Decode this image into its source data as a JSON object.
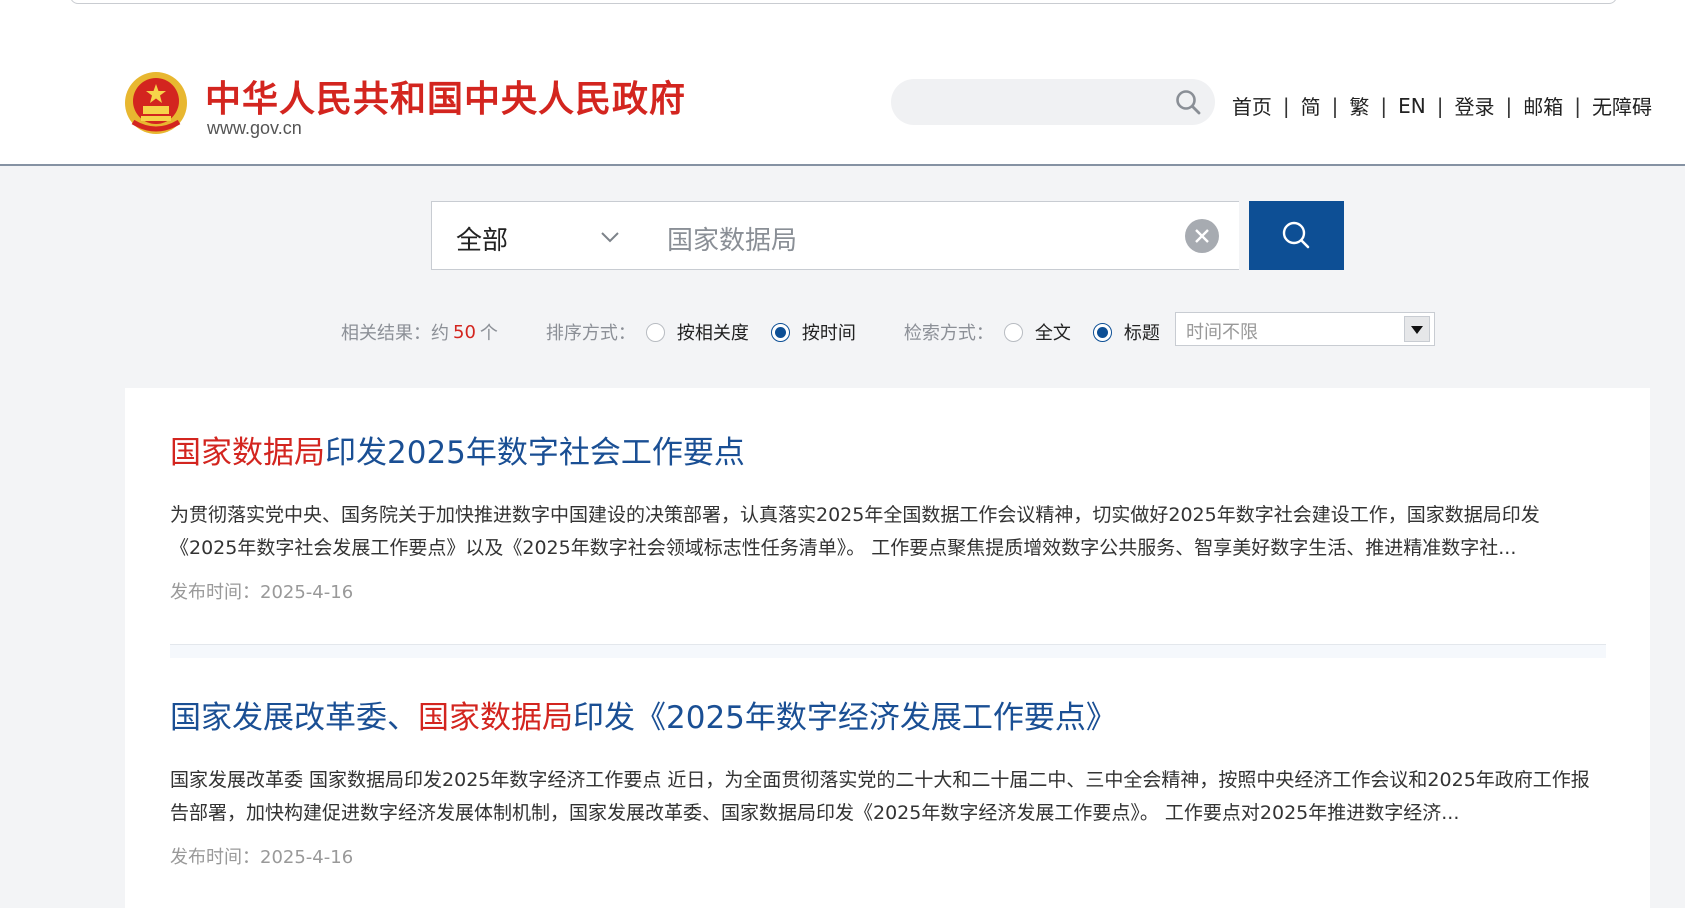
{
  "header": {
    "brand_title": "中华人民共和国中央人民政府",
    "brand_url": "www.gov.cn",
    "nav": [
      "首页",
      "简",
      "繁",
      "EN",
      "登录",
      "邮箱",
      "无障碍"
    ],
    "nav_separator": "|",
    "search_icon": "search-icon"
  },
  "search": {
    "scope": "全部",
    "query": "国家数据局",
    "clear_icon": "close-circle-icon",
    "submit_icon": "search-icon"
  },
  "filters": {
    "results_label": "相关结果：约",
    "results_count": "50",
    "results_unit": "个",
    "sort_label": "排序方式：",
    "sort_options": [
      "按相关度",
      "按时间"
    ],
    "sort_selected": "按时间",
    "mode_label": "检索方式：",
    "mode_options": [
      "全文",
      "标题"
    ],
    "mode_selected": "标题",
    "time_filter": "时间不限"
  },
  "results": [
    {
      "title_highlight": "国家数据局",
      "title_rest": "印发2025年数字社会工作要点",
      "summary": "为贯彻落实党中央、国务院关于加快推进数字中国建设的决策部署，认真落实2025年全国数据工作会议精神，切实做好2025年数字社会建设工作，国家数据局印发《2025年数字社会发展工作要点》以及《2025年数字社会领域标志性任务清单》。 工作要点聚焦提质增效数字公共服务、智享美好数字生活、推进精准数字社...",
      "date_label": "发布时间：",
      "date": "2025-4-16"
    },
    {
      "title_prefix": "国家发展改革委、",
      "title_highlight": "国家数据局",
      "title_rest": "印发《2025年数字经济发展工作要点》",
      "summary": "国家发展改革委 国家数据局印发2025年数字经济工作要点 近日，为全面贯彻落实党的二十大和二十届二中、三中全会精神，按照中央经济工作会议和2025年政府工作报告部署，加快构建促进数字经济发展体制机制，国家发展改革委、国家数据局印发《2025年数字经济发展工作要点》。 工作要点对2025年推进数字经济...",
      "date_label": "发布时间：",
      "date": "2025-4-16"
    }
  ],
  "colors": {
    "brand_red": "#d3251f",
    "link_blue": "#1a4f94",
    "button_blue": "#0d4f95"
  }
}
